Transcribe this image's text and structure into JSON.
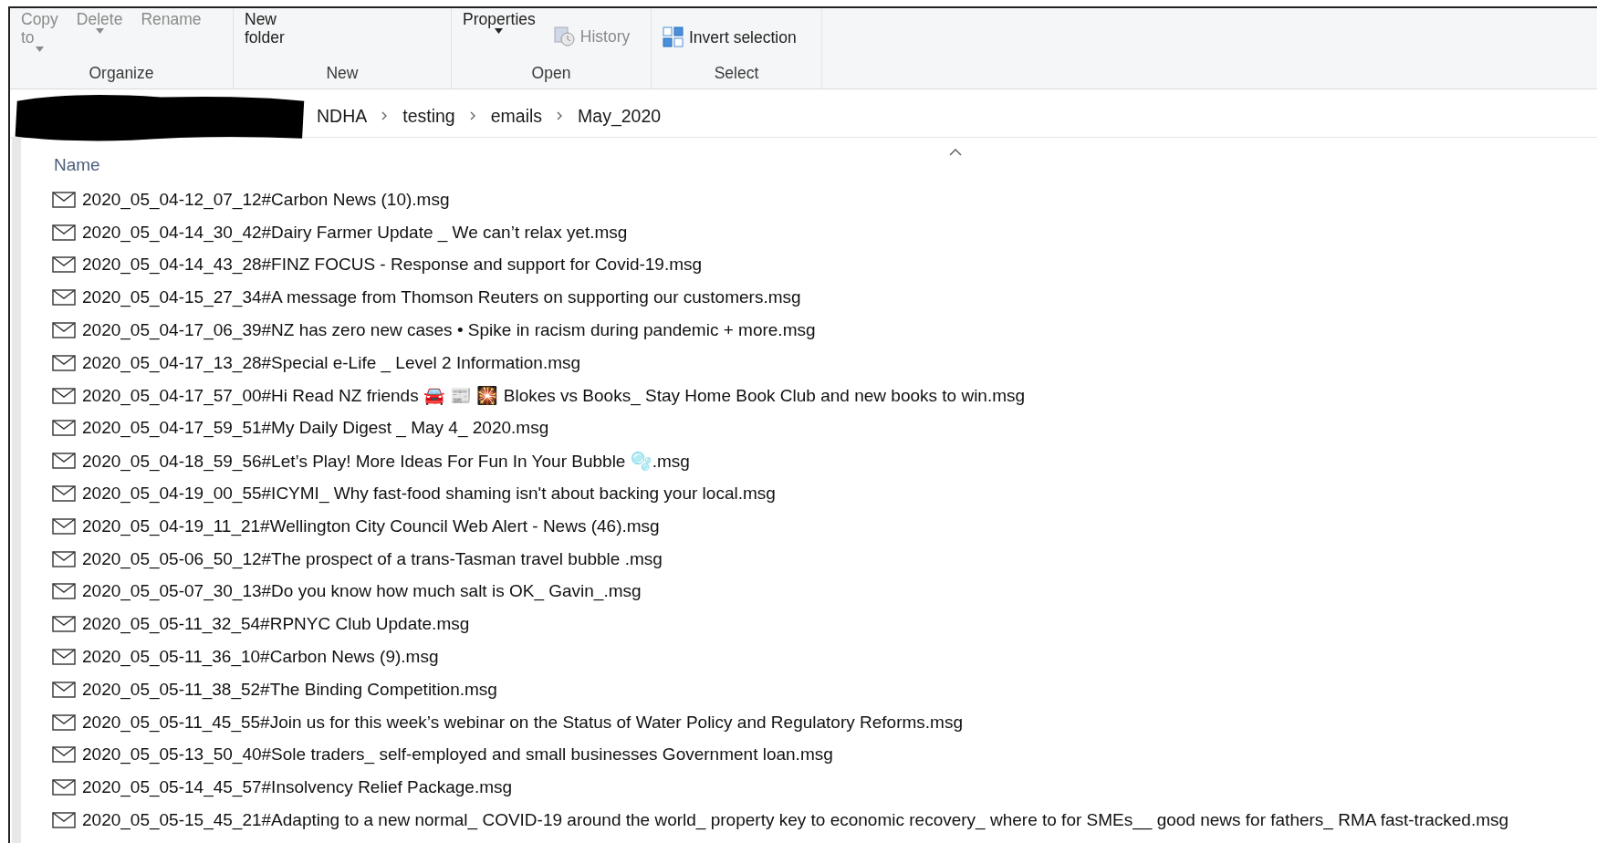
{
  "ribbon": {
    "groups": [
      {
        "label": "Organize",
        "commands": [
          {
            "label": "Copy\nto",
            "kind": "dropdown",
            "disabled": true
          },
          {
            "label": "Delete",
            "kind": "dropdown",
            "disabled": true
          },
          {
            "label": "Rename",
            "kind": "plain",
            "disabled": true
          }
        ]
      },
      {
        "label": "New",
        "commands": [
          {
            "label": "New\nfolder",
            "kind": "plain",
            "disabled": false
          }
        ]
      },
      {
        "label": "Open",
        "commands": [
          {
            "label": "Properties",
            "kind": "dropdown",
            "disabled": false
          },
          {
            "label": "History",
            "kind": "history",
            "disabled": true
          }
        ]
      },
      {
        "label": "Select",
        "commands": [
          {
            "label": "Invert selection",
            "kind": "invert",
            "disabled": false
          }
        ]
      }
    ]
  },
  "address_bar": {
    "crumbs": [
      "NDHA",
      "testing",
      "emails",
      "May_2020"
    ]
  },
  "file_list": {
    "columns": [
      {
        "label": "Name",
        "sorted": true
      }
    ],
    "rows": [
      {
        "name": "2020_05_04-12_07_12#Carbon News (10).msg"
      },
      {
        "name": "2020_05_04-14_30_42#Dairy Farmer Update _ We can’t relax yet.msg"
      },
      {
        "name": "2020_05_04-14_43_28#FINZ FOCUS - Response and support for Covid-19.msg"
      },
      {
        "name": "2020_05_04-15_27_34#A message from Thomson Reuters on supporting our customers.msg"
      },
      {
        "name": "2020_05_04-17_06_39#NZ has zero new cases • Spike in racism during pandemic + more.msg"
      },
      {
        "name": "2020_05_04-17_13_28#Special e-Life _ Level 2 Information.msg"
      },
      {
        "name": "2020_05_04-17_57_00#Hi Read NZ friends 🚘 📰 🎇 Blokes vs Books_ Stay Home Book Club and new books to win.msg"
      },
      {
        "name": "2020_05_04-17_59_51#My Daily Digest _ May 4_ 2020.msg"
      },
      {
        "name": "2020_05_04-18_59_56#Let’s Play! More Ideas For Fun In Your Bubble 🫧.msg"
      },
      {
        "name": "2020_05_04-19_00_55#ICYMI_ Why fast-food shaming isn't about backing your local.msg"
      },
      {
        "name": "2020_05_04-19_11_21#Wellington City Council Web Alert - News (46).msg"
      },
      {
        "name": "2020_05_05-06_50_12#The prospect of a trans-Tasman travel bubble .msg"
      },
      {
        "name": "2020_05_05-07_30_13#Do you know how much salt is OK_ Gavin_.msg"
      },
      {
        "name": "2020_05_05-11_32_54#RPNYC Club Update.msg"
      },
      {
        "name": "2020_05_05-11_36_10#Carbon News (9).msg"
      },
      {
        "name": "2020_05_05-11_38_52#The Binding Competition.msg"
      },
      {
        "name": "2020_05_05-11_45_55#Join us for this week’s webinar on the Status of Water Policy and Regulatory Reforms.msg"
      },
      {
        "name": "2020_05_05-13_50_40#Sole traders_ self-employed and small businesses Government loan.msg"
      },
      {
        "name": "2020_05_05-14_45_57#Insolvency Relief Package.msg"
      },
      {
        "name": "2020_05_05-15_45_21#Adapting to a new normal_ COVID-19 around the world_ property key to economic recovery_ where to for SMEs__ good news for fathers_ RMA fast-tracked.msg"
      }
    ]
  }
}
